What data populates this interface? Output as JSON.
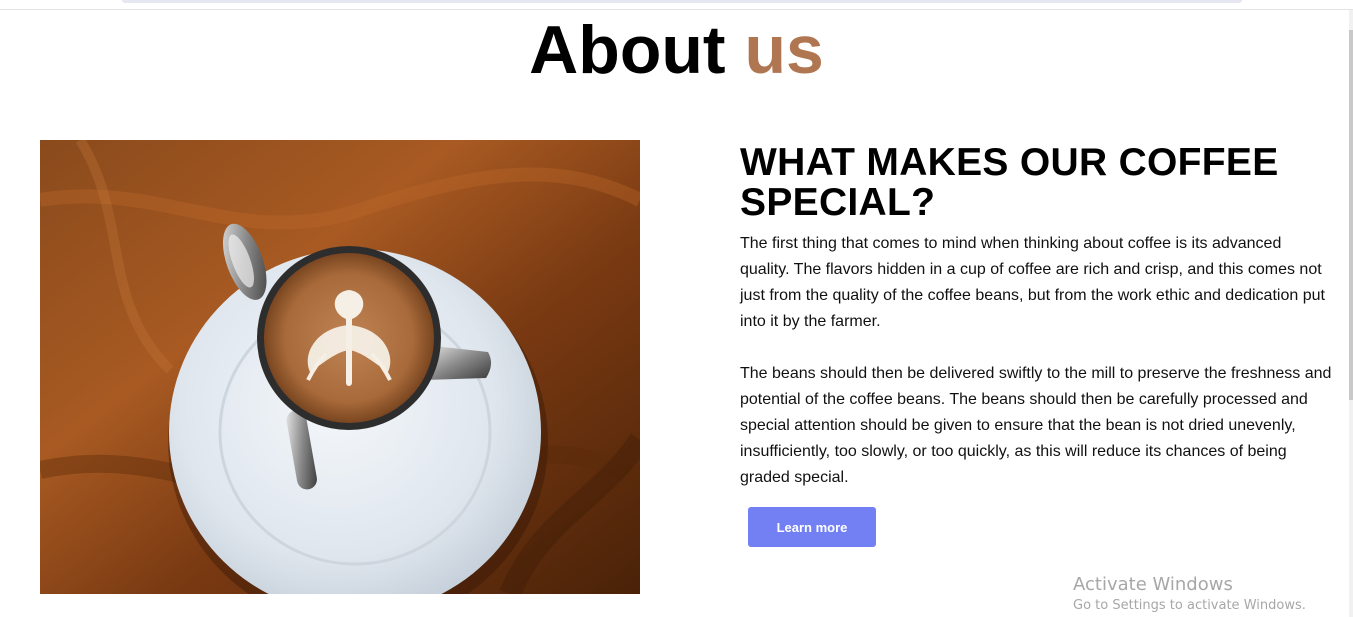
{
  "page": {
    "title_main": "About",
    "title_accent": "us",
    "accent_color": "#b07651"
  },
  "about": {
    "image": {
      "alt": "Latte art cup of coffee on a saucer with a spoon on a wooden table",
      "icon": "coffee-photo"
    },
    "heading": "WHAT MAKES OUR COFFEE SPECIAL?",
    "paragraphs": [
      "The first thing that comes to mind when thinking about coffee is its advanced quality. The flavors hidden in a cup of coffee are rich and crisp, and this comes not just from the quality of the coffee beans, but from the work ethic and dedication put into it by the farmer.",
      "The beans should then be delivered swiftly to the mill to preserve the freshness and potential of the coffee beans. The beans should then be carefully processed and special attention should be given to ensure that the bean is not dried unevenly, insufficiently, too slowly, or too quickly, as this will reduce its chances of being graded special."
    ],
    "button_label": "Learn more",
    "button_color": "#7280f3"
  },
  "watermark": {
    "title": "Activate Windows",
    "subtitle": "Go to Settings to activate Windows."
  }
}
